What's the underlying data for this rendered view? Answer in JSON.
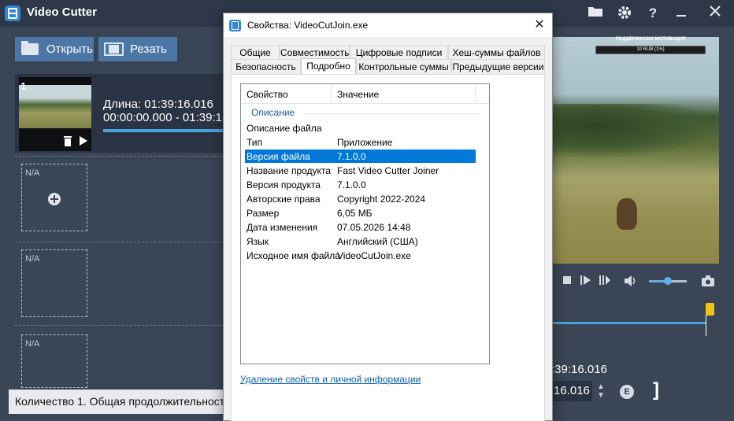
{
  "app": {
    "title": "Video Cutter",
    "toolbar": {
      "open_label": "Открыть",
      "cut_label": "Резать"
    },
    "icons": [
      "folder-icon",
      "gear-icon",
      "help-icon",
      "minimize-icon",
      "close-icon"
    ],
    "clip": {
      "index": "1",
      "duration": "Длина: 01:39:16.016",
      "range": "00:00:00.000  -  01:39:16"
    },
    "empty_slot_label": "N/A",
    "status": "Количество 1. Общая продолжительность",
    "video_overlay": {
      "banner": "ПОДДЕРЖКА/КИ МОТИВАЦИЯ",
      "bar": "10 RUB (1%)"
    },
    "time_end_1": ":39:16.016",
    "time_end_2": "16.016",
    "help_glyph": "?",
    "export_glyph": "E",
    "bracket": "]"
  },
  "dialog": {
    "title": "Свойства: VideoCutJoin.exe",
    "tabs_row1": [
      "Общие",
      "Совместимость",
      "Цифровые подписи",
      "Хеш-суммы файлов"
    ],
    "tabs_row2": [
      "Безопасность",
      "Подробно",
      "Контрольные суммы",
      "Предыдущие версии"
    ],
    "active_tab": "Подробно",
    "columns": {
      "property": "Свойство",
      "value": "Значение"
    },
    "group": "Описание",
    "rows": [
      {
        "name": "Описание файла",
        "value": ""
      },
      {
        "name": "Тип",
        "value": "Приложение"
      },
      {
        "name": "Версия файла",
        "value": "7.1.0.0",
        "selected": true
      },
      {
        "name": "Название продукта",
        "value": "Fast Video Cutter Joiner"
      },
      {
        "name": "Версия продукта",
        "value": "7.1.0.0"
      },
      {
        "name": "Авторские права",
        "value": "Copyright 2022-2024"
      },
      {
        "name": "Размер",
        "value": "6,05 МБ"
      },
      {
        "name": "Дата изменения",
        "value": "07.05.2026 14:48"
      },
      {
        "name": "Язык",
        "value": "Английский (США)"
      },
      {
        "name": "Исходное имя файла",
        "value": "VideoCutJoin.exe"
      }
    ],
    "remove_link": "Удаление свойств и личной информации",
    "selection_color": "#0078d7"
  }
}
